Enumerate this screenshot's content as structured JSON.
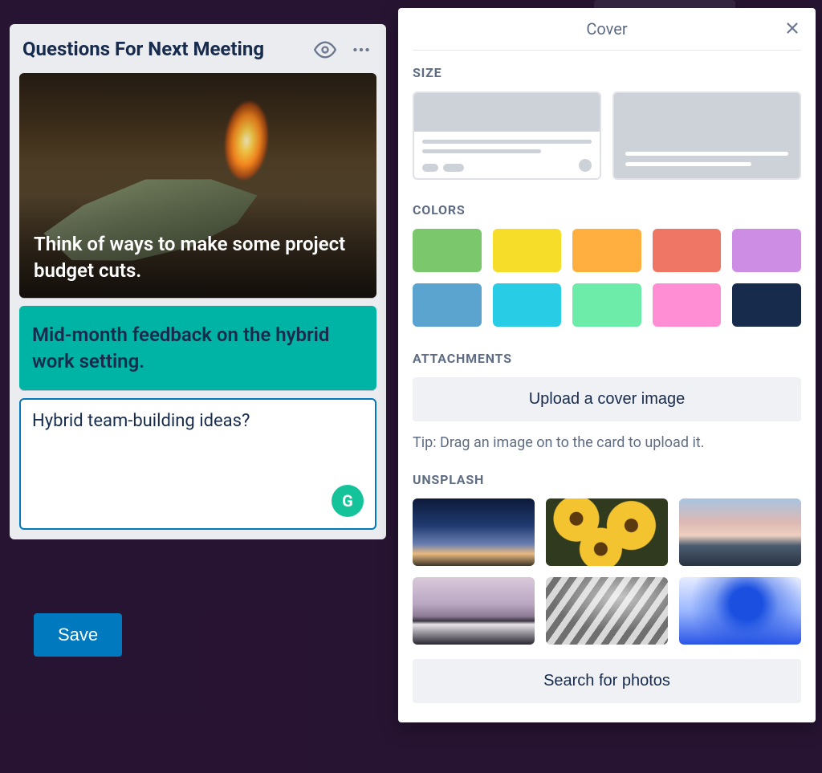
{
  "list": {
    "title": "Questions For Next Meeting",
    "cards": [
      {
        "text": "Think of ways to make some project budget cuts."
      },
      {
        "text": "Mid-month feedback on the hybrid work setting."
      }
    ],
    "new_card": {
      "text": "Hybrid team-building ideas?"
    },
    "save_label": "Save"
  },
  "cover_panel": {
    "title": "Cover",
    "sections": {
      "size": "SIZE",
      "colors": "COLORS",
      "attachments": "ATTACHMENTS",
      "unsplash": "UNSPLASH"
    },
    "upload_label": "Upload a cover image",
    "tip": "Tip: Drag an image on to the card to upload it.",
    "search_label": "Search for photos",
    "colors": [
      "#7bc86c",
      "#f5dd29",
      "#ffaf3f",
      "#ef7564",
      "#cd8de5",
      "#5ba4cf",
      "#29cce5",
      "#6deca9",
      "#ff8ed4",
      "#172b4d"
    ],
    "unsplash_thumbs": [
      "night-sky",
      "sunflowers",
      "pink-sunset-sea",
      "snow-mountain",
      "architecture-curves",
      "blue-ink-water"
    ]
  },
  "grammarly_badge": "G"
}
